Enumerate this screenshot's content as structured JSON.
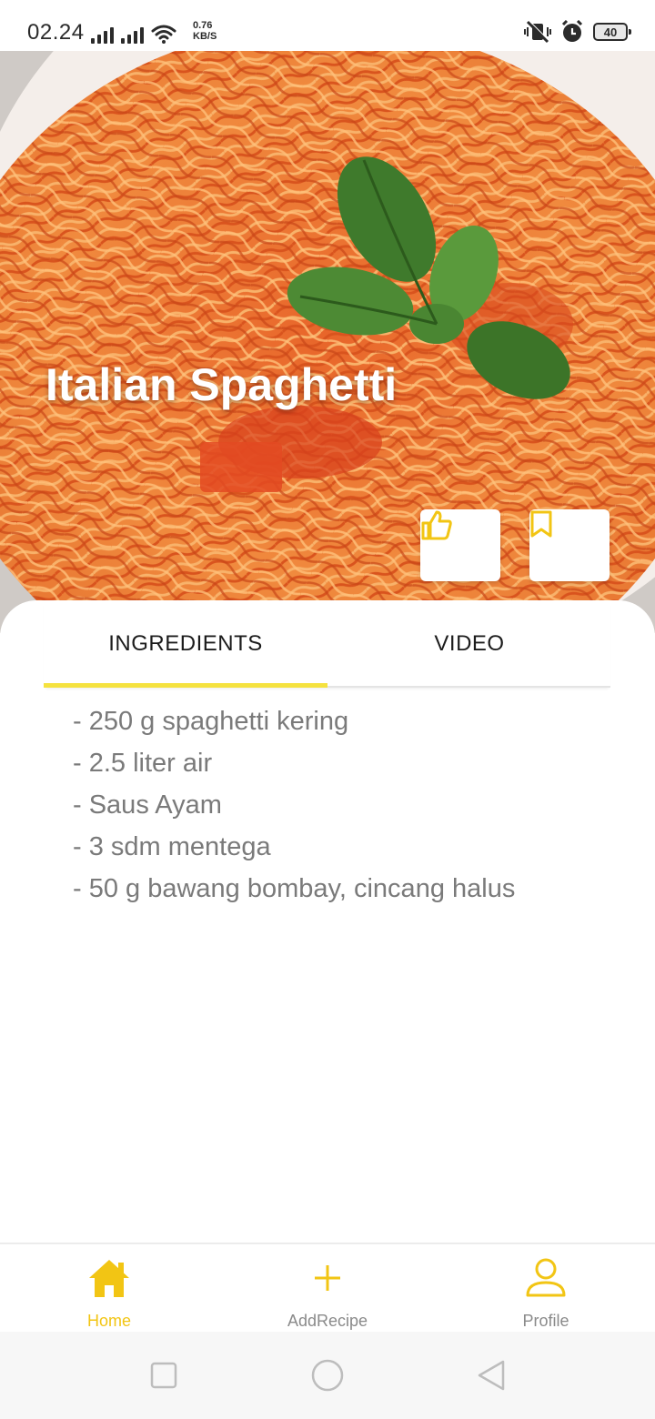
{
  "status_bar": {
    "time": "02.24",
    "speed_value": "0.76",
    "speed_unit": "KB/S",
    "battery": "40"
  },
  "recipe": {
    "title": "Italian Spaghetti",
    "like_icon": "thumbs-up-icon",
    "bookmark_icon": "bookmark-icon"
  },
  "tabs": [
    {
      "label": "INGREDIENTS",
      "active": true
    },
    {
      "label": "VIDEO",
      "active": false
    }
  ],
  "ingredients": [
    "- 250 g spaghetti kering",
    "- 2.5 liter air",
    "- Saus Ayam",
    "- 3 sdm mentega",
    "- 50 g bawang bombay, cincang halus"
  ],
  "bottom_nav": [
    {
      "label": "Home",
      "icon": "home-icon",
      "active": true
    },
    {
      "label": "AddRecipe",
      "icon": "plus-icon",
      "active": false
    },
    {
      "label": "Profile",
      "icon": "person-icon",
      "active": false
    }
  ],
  "colors": {
    "accent": "#f2c514",
    "tab_indicator": "#f5e23f",
    "ingredient_text": "#7a7a7a"
  }
}
